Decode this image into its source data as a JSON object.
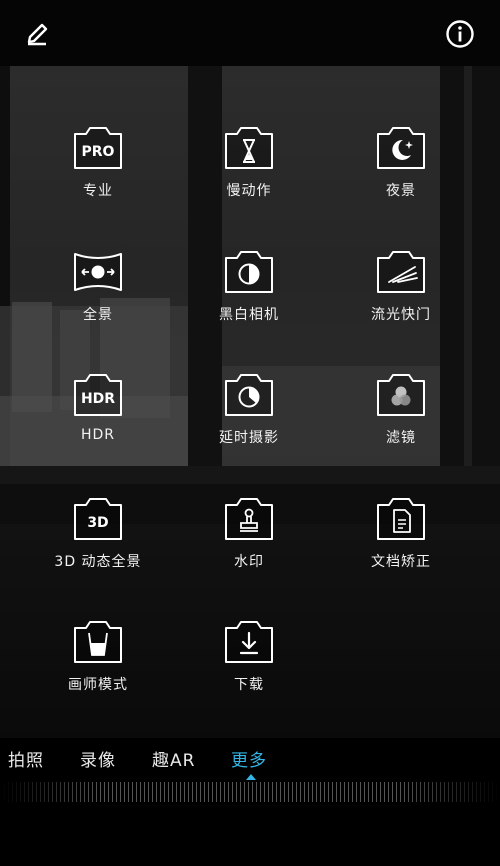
{
  "header": {
    "edit_icon": "pencil-icon",
    "info_icon": "info-icon"
  },
  "modes": [
    {
      "label": "专业",
      "icon": "pro-icon",
      "icon_text": "PRO"
    },
    {
      "label": "慢动作",
      "icon": "hourglass-icon"
    },
    {
      "label": "夜景",
      "icon": "moon-icon"
    },
    {
      "label": "全景",
      "icon": "panorama-icon"
    },
    {
      "label": "黑白相机",
      "icon": "contrast-icon"
    },
    {
      "label": "流光快门",
      "icon": "speed-lines-icon"
    },
    {
      "label": "HDR",
      "icon": "hdr-icon",
      "icon_text": "HDR"
    },
    {
      "label": "延时摄影",
      "icon": "timelapse-icon"
    },
    {
      "label": "滤镜",
      "icon": "filter-circles-icon"
    },
    {
      "label": "3D 动态全景",
      "icon": "3d-icon",
      "icon_text": "3D"
    },
    {
      "label": "水印",
      "icon": "stamp-icon"
    },
    {
      "label": "文档矫正",
      "icon": "document-icon"
    },
    {
      "label": "画师模式",
      "icon": "paint-cup-icon"
    },
    {
      "label": "下载",
      "icon": "download-icon"
    }
  ],
  "tabs": [
    {
      "label": "拍照",
      "active": false
    },
    {
      "label": "录像",
      "active": false
    },
    {
      "label": "趣AR",
      "active": false
    },
    {
      "label": "更多",
      "active": true
    }
  ],
  "colors": {
    "accent": "#33b5e5"
  }
}
